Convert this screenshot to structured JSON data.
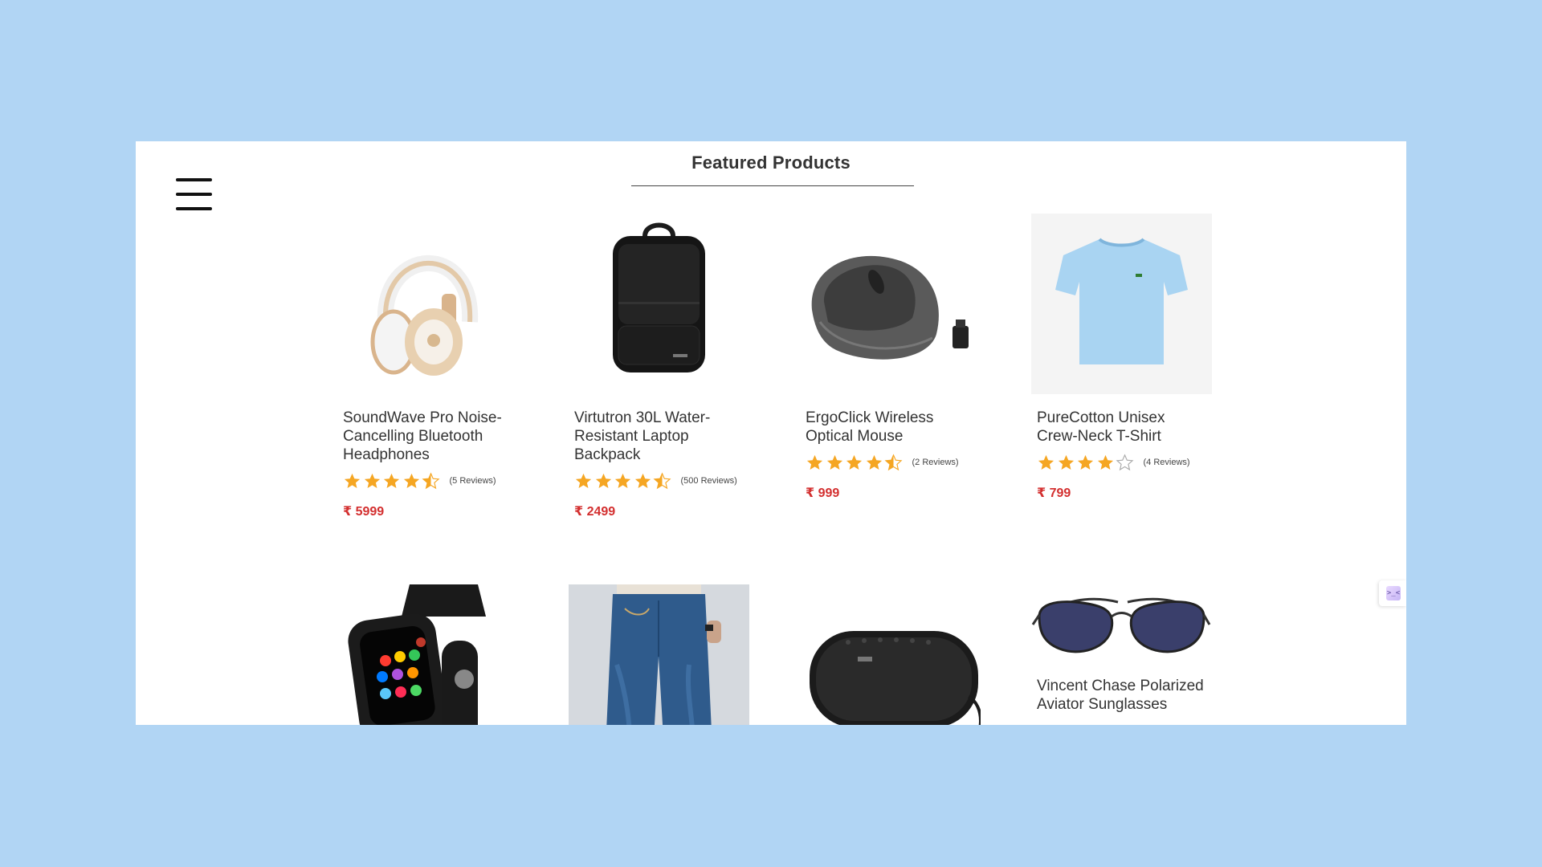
{
  "page": {
    "title": "Featured Products",
    "currency": "₹",
    "side_widget_glyph": ">_<"
  },
  "products": [
    {
      "name": "SoundWave Pro Noise-Cancelling Bluetooth Headphones",
      "rating": 4.5,
      "reviews": "(5 Reviews)",
      "price": "₹ 5999",
      "image": "headphones-image"
    },
    {
      "name": "Virtutron 30L Water-Resistant Laptop Backpack",
      "rating": 4.5,
      "reviews": "(500 Reviews)",
      "price": "₹ 2499",
      "image": "backpack-image"
    },
    {
      "name": "ErgoClick Wireless Optical Mouse",
      "rating": 4.5,
      "reviews": "(2 Reviews)",
      "price": "₹ 999",
      "image": "mouse-image"
    },
    {
      "name": "PureCotton Unisex Crew-Neck T-Shirt",
      "rating": 4,
      "reviews": "(4 Reviews)",
      "price": "₹ 799",
      "image": "tshirt-image"
    },
    {
      "name": "",
      "image": "smartwatch-image"
    },
    {
      "name": "",
      "image": "jeans-image"
    },
    {
      "name": "",
      "image": "speaker-image"
    },
    {
      "name": "Vincent Chase Polarized Aviator Sunglasses",
      "image": "sunglasses-image"
    }
  ],
  "colors": {
    "background": "#b1d5f4",
    "star": "#f5a623",
    "price": "#d32f2f"
  }
}
